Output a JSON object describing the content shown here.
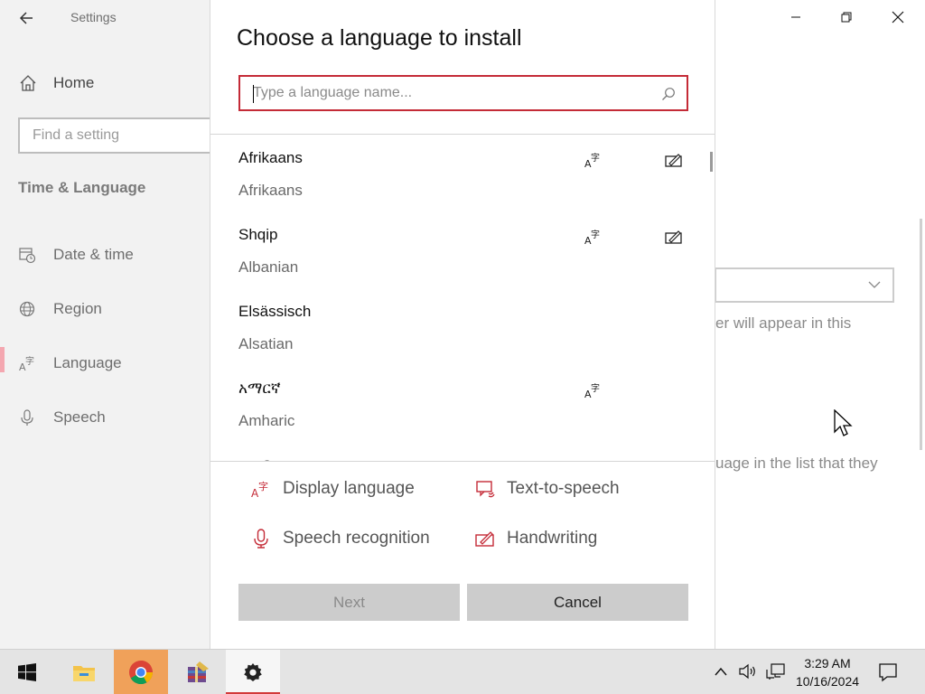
{
  "settings": {
    "title": "Settings",
    "nav": {
      "home_label": "Home",
      "search_placeholder": "Find a setting",
      "section_title": "Time & Language",
      "items": [
        {
          "label": "Date & time",
          "icon": "calendar-clock-icon"
        },
        {
          "label": "Region",
          "icon": "globe-icon"
        },
        {
          "label": "Language",
          "icon": "language-icon",
          "active": true
        },
        {
          "label": "Speech",
          "icon": "microphone-icon"
        }
      ]
    },
    "main": {
      "text_fragment_1": "er will appear in this",
      "text_fragment_2": "uage in the list that they"
    }
  },
  "dialog": {
    "title": "Choose a language to install",
    "search_placeholder": "Type a language name...",
    "search_value": "",
    "languages": [
      {
        "native": "Afrikaans",
        "english": "Afrikaans",
        "display_language": true,
        "handwriting": true
      },
      {
        "native": "Shqip",
        "english": "Albanian",
        "display_language": true,
        "handwriting": true
      },
      {
        "native": "Elsässisch",
        "english": "Alsatian",
        "display_language": false,
        "handwriting": false
      },
      {
        "native": "አማርኛ",
        "english": "Amharic",
        "display_language": true,
        "handwriting": false
      }
    ],
    "legend": {
      "display_language": "Display language",
      "text_to_speech": "Text-to-speech",
      "speech_recognition": "Speech recognition",
      "handwriting": "Handwriting"
    },
    "buttons": {
      "next": "Next",
      "cancel": "Cancel"
    }
  },
  "taskbar": {
    "time": "3:29 AM",
    "date": "10/16/2024",
    "apps": [
      "start-icon",
      "file-explorer-icon",
      "chrome-icon",
      "archive-tool-icon",
      "settings-gear-icon"
    ]
  },
  "colors": {
    "accent_red": "#c42b37",
    "chrome_highlight": "#f0a15a",
    "nav_accent": "#f4a7b0"
  }
}
